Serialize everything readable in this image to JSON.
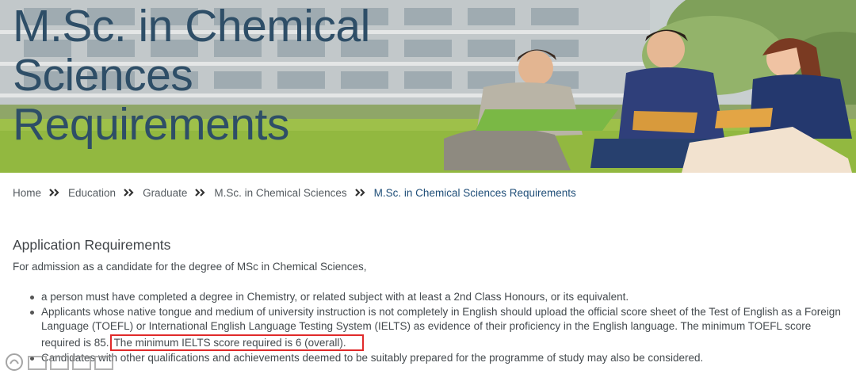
{
  "hero": {
    "title_lines": [
      "M.Sc. in Chemical",
      "Sciences",
      "Requirements"
    ]
  },
  "breadcrumb": [
    {
      "label": "Home"
    },
    {
      "label": "Education"
    },
    {
      "label": "Graduate"
    },
    {
      "label": "M.Sc. in Chemical Sciences"
    },
    {
      "label": "M.Sc. in Chemical Sciences Requirements"
    }
  ],
  "content": {
    "heading": "Application Requirements",
    "intro": "For admission as a candidate for the degree of MSc in Chemical Sciences,",
    "items": [
      "a person must have completed a degree in Chemistry, or related subject with at least a 2nd Class Honours, or its equivalent.",
      "Applicants whose native tongue and medium of university instruction is not completely in English should upload the official score sheet of the Test of English as a Foreign Language (TOEFL) or International English Language Testing System (IELTS) as evidence of their proficiency in the English language. The minimum TOEFL score required is 85.",
      "Candidates with other qualifications and achievements deemed to be suitably prepared for the programme of study may also be considered."
    ],
    "item2_highlight": "The minimum IELTS score required is 6 (overall)."
  },
  "colors": {
    "title": "#2e4e67",
    "breadcrumb_current": "#1f4e78",
    "highlight_border": "#e02a2a"
  }
}
